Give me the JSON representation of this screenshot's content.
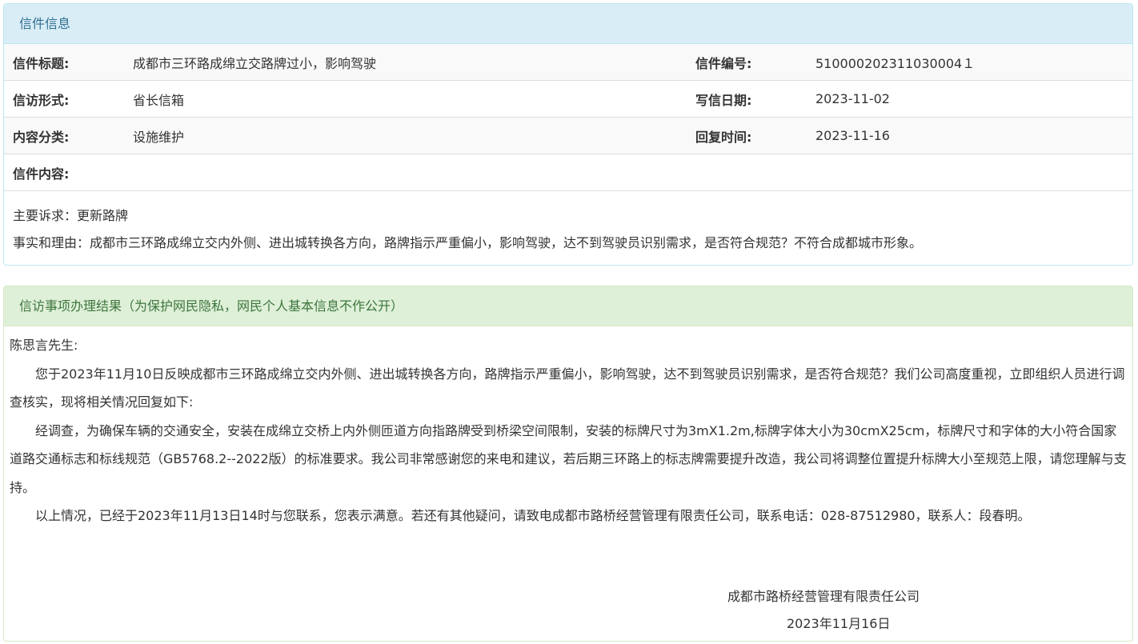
{
  "letter_info": {
    "heading": "信件信息",
    "rows": [
      {
        "label1": "信件标题:",
        "value1": "成都市三环路成绵立交路牌过小，影响驾驶",
        "label2": "信件编号:",
        "value2": "510000202311030004１"
      },
      {
        "label1": "信访形式:",
        "value1": "省长信箱",
        "label2": "写信日期:",
        "value2": "2023-11-02"
      },
      {
        "label1": "内容分类:",
        "value1": "设施维护",
        "label2": "回复时间:",
        "value2": "2023-11-16"
      }
    ],
    "content_label": "信件内容:",
    "content_lines": [
      "主要诉求：更新路牌",
      "事实和理由：成都市三环路成绵立交内外侧、进出城转换各方向，路牌指示严重偏小，影响驾驶，达不到驾驶员识别需求，是否符合规范？不符合成都城市形象。"
    ]
  },
  "result": {
    "heading": "信访事项办理结果（为保护网民隐私，网民个人基本信息不作公开）",
    "salutation": "陈思言先生:",
    "paragraphs": [
      "您于2023年11月10日反映成都市三环路成绵立交内外侧、进出城转换各方向，路牌指示严重偏小，影响驾驶，达不到驾驶员识别需求，是否符合规范？我们公司高度重视，立即组织人员进行调查核实，现将相关情况回复如下:",
      "经调查，为确保车辆的交通安全，安装在成绵立交桥上内外侧匝道方向指路牌受到桥梁空间限制，安装的标牌尺寸为3mX1.2m,标牌字体大小为30cmX25cm，标牌尺寸和字体的大小符合国家道路交通标志和标线规范（GB5768.2--2022版）的标准要求。我公司非常感谢您的来电和建议，若后期三环路上的标志牌需要提升改造，我公司将调整位置提升标牌大小至规范上限，请您理解与支持。",
      "以上情况，已经于2023年11月13日14时与您联系，您表示满意。若还有其他疑问，请致电成都市路桥经营管理有限责任公司，联系电话：028-87512980，联系人：段春明。"
    ],
    "signature_org": "成都市路桥经营管理有限责任公司",
    "signature_date": "2023年11月16日"
  }
}
